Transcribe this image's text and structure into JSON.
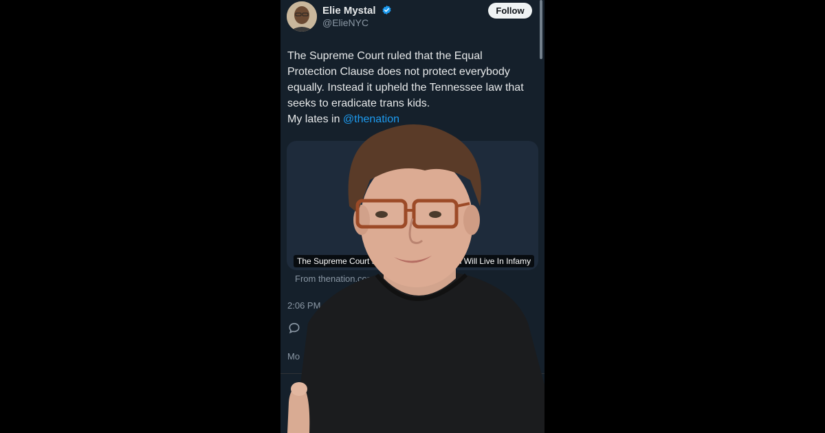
{
  "tweet": {
    "author_name": "Elie Mystal",
    "author_handle": "@ElieNYC",
    "follow_label": "Follow",
    "text_lines": [
      "The Supreme Court ruled that the Equal",
      "Protection Clause does not protect everybody",
      "equally. Instead it upheld the Tennessee law that",
      "seeks to eradicate trans kids."
    ],
    "lates_prefix": "My lates in ",
    "mention": "@thenation",
    "card_caption": "The Supreme Court s",
    "card_caption_tail": "n Will Live In Infamy",
    "card_source": "From thenation.com",
    "timestamp": "2:06 PM",
    "more_label": "Mo"
  },
  "colors": {
    "background": "#15202b",
    "text": "#e7e9ea",
    "secondary": "#8b98a5",
    "link": "#1d9bf0",
    "verified": "#1d9bf0"
  },
  "icons": [
    "verified-badge-icon",
    "reply-icon"
  ]
}
